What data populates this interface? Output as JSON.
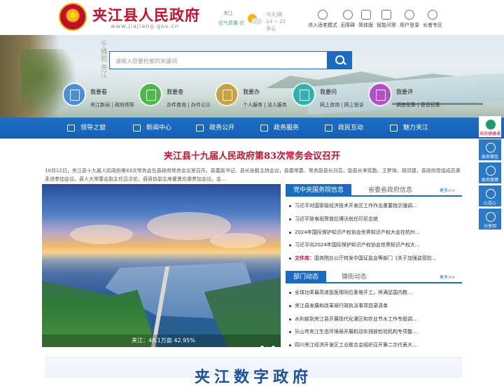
{
  "header": {
    "title": "夹江县人民政府",
    "url": "www.jiajiang.gov.cn",
    "weather": {
      "city": "夹江",
      "air_quality": "空气质量 优",
      "line1": "今天|晴",
      "line2": "14 ~ 22",
      "line3": "多云"
    },
    "tools": [
      {
        "label": "进入适老模式",
        "icon": "elderly-icon"
      },
      {
        "label": "无障碍",
        "icon": "accessibility-icon"
      },
      {
        "label": "简体版",
        "icon": "language-icon"
      },
      {
        "label": "智能问答",
        "icon": "chat-icon"
      },
      {
        "label": "用户登录",
        "icon": "user-icon"
      },
      {
        "label": "长者专区",
        "icon": "senior-icon"
      }
    ]
  },
  "search": {
    "placeholder": "请输入您要检索的关键词"
  },
  "quick_links": [
    {
      "title": "我要看",
      "sub": "夹江新闻 | 政府领导",
      "color": "#4a8fd8",
      "icon": "view-icon"
    },
    {
      "title": "我要查",
      "sub": "办件查询 | 办件公示",
      "color": "#4fb84a",
      "icon": "search-doc-icon"
    },
    {
      "title": "我要办",
      "sub": "个人服务 | 法人服务",
      "color": "#c9a240",
      "icon": "service-icon"
    },
    {
      "title": "我要问",
      "sub": "网上咨询 | 网上投诉",
      "color": "#2fb3b0",
      "icon": "question-icon"
    },
    {
      "title": "我要评",
      "sub": "调查征集 | 意见征集",
      "color": "#b44fc9",
      "icon": "review-icon"
    }
  ],
  "nav": [
    {
      "label": "领导之窗",
      "icon": "leader-icon"
    },
    {
      "label": "新闻中心",
      "icon": "news-icon"
    },
    {
      "label": "政务公开",
      "icon": "open-gov-icon"
    },
    {
      "label": "政务服务",
      "icon": "gov-service-icon"
    },
    {
      "label": "政民互动",
      "icon": "interaction-icon"
    },
    {
      "label": "魅力夹江",
      "icon": "charm-icon"
    }
  ],
  "side": [
    {
      "label": "天府健康通"
    },
    {
      "label": "政务微信"
    },
    {
      "label": "政务微博"
    },
    {
      "label": "心连心"
    },
    {
      "label": "分享到"
    }
  ],
  "headline": {
    "title": "夹江县十九届人民政府第83次常务会议召开",
    "summary": "10月12日，夹江县十九届人民政府第83次常务会在县政府常务会议室召开。县委副书记、县长张毅主持会议，县委常委、常务副县长刘蕊，副县长李宪勤、王梦琦、胡洪捷，县政府党组成员黄永进参加会议。县人大常委会副主任吕汶伦，县政协副主席夏勇应邀参加会议。会..."
  },
  "photo": {
    "caption": "夹江：48.1万亩 42.95%"
  },
  "tabs1": {
    "active": "党中央国务院信息",
    "other": "省委省政府信息",
    "more": "更多>>"
  },
  "news1": [
    "习近平对国家级经济技术开发区工作作出重要指示强调...",
    "习近平致电祝贺普拉博沃就任印尼总统",
    "2024年国际保护知识产权协会世界知识产权大会在杭州...",
    "习近平向2024年国际保护知识产权协会世界知识产权大...",
    {
      "label": "文件库：",
      "text": "国务院办公厅转发中国证监会等部门《关于加强监管防..."
    }
  ],
  "tabs2": {
    "active": "部门动态",
    "other": "镇街动态",
    "more": "更多>>"
  },
  "news2": [
    "全球功率最高液氢医用同位素堆开工，将满足国内数...",
    "夹江县发展和改革局行政执法事项目录清单",
    "水利部到夹江县开展现代化灌区和农业节水工作专题调...",
    "乐山市夹江生态环境局开展机动车排放检验机构专项整...",
    "四川夹江经济开发区工业联合会组织召开第二次代表大..."
  ],
  "digital": {
    "title": "夹江数字政府"
  }
}
